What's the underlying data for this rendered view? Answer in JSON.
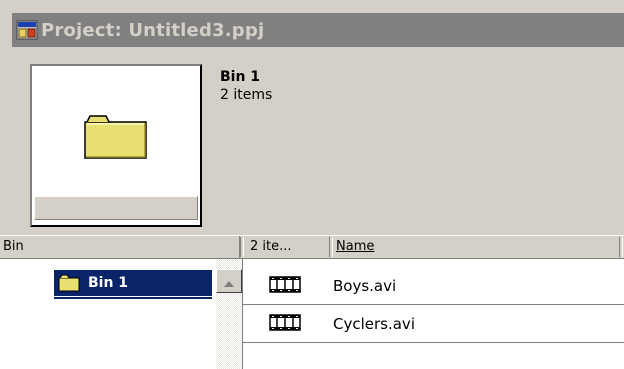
{
  "window": {
    "title": "Project: Untitled3.ppj",
    "title_icon": "project-icon"
  },
  "preview": {
    "name": "Bin 1",
    "count": "2 items",
    "icon": "folder-icon"
  },
  "columns": {
    "bin": "Bin",
    "count": "2 ite...",
    "name": "Name"
  },
  "bins": [
    {
      "label": "Bin 1",
      "icon": "folder-icon",
      "selected": true
    }
  ],
  "files": [
    {
      "name": "Boys.avi",
      "icon": "film-strip-icon"
    },
    {
      "name": "Cyclers.avi",
      "icon": "film-strip-icon"
    }
  ],
  "colors": {
    "selection": "#0a246a",
    "titlebar": "#808080",
    "face": "#d4d0c8"
  }
}
